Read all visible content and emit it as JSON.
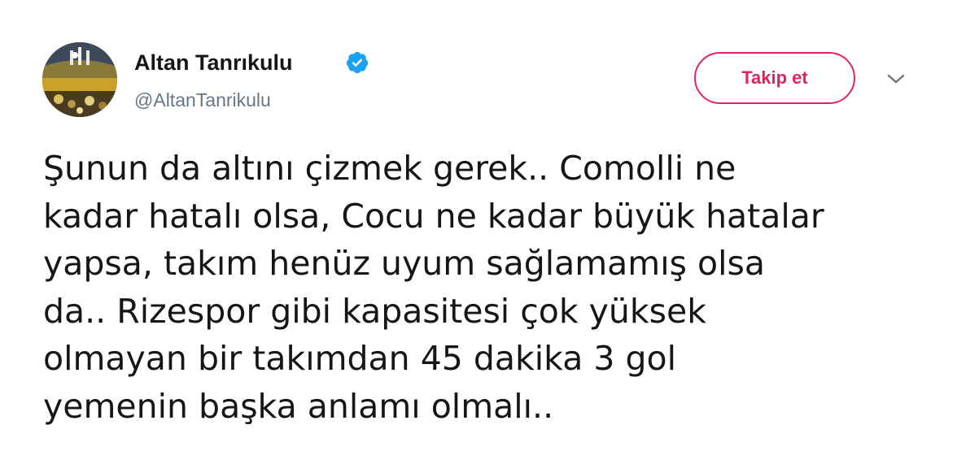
{
  "tweet": {
    "author": {
      "display_name": "Altan Tanrıkulu",
      "username": "@AltanTanrikulu",
      "verified": true,
      "avatar_icon": "profile-photo-stadium-crowd"
    },
    "follow_button": {
      "label": "Takip et",
      "color": "#e0245e"
    },
    "menu_icon": "chevron-down-icon",
    "text_lines": [
      "Şunun da altını çizmek gerek.. Comolli ne",
      "kadar hatalı olsa, Cocu ne kadar büyük hatalar",
      "yapsa, takım henüz uyum sağlamamış olsa",
      "da.. Rizespor gibi kapasitesi çok yüksek",
      "olmayan bir takımdan 45 dakika 3 gol",
      "yemenin başka anlamı olmalı.."
    ]
  },
  "colors": {
    "text_primary": "#14171a",
    "text_secondary": "#657786",
    "verified_blue": "#1da1f2",
    "follow_accent": "#e0245e"
  }
}
